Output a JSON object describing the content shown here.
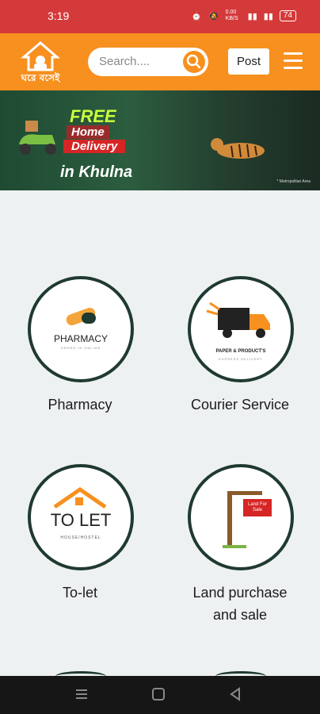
{
  "status_bar": {
    "time": "3:19",
    "data_speed": "0.00 KB/S",
    "battery": "74"
  },
  "app_bar": {
    "logo_text": "ঘরে বসেই",
    "search_placeholder": "Search....",
    "post_label": "Post"
  },
  "banner": {
    "line1": "FREE",
    "line2": "Home",
    "line3": "Delivery",
    "line4": "in Khulna",
    "note": "* Metropolitan Area"
  },
  "services": [
    {
      "label": "Pharmacy",
      "image_text": "PHARMACY",
      "image_subtext": "ORDER IN ONLINE"
    },
    {
      "label": "Courier Service",
      "image_text": "PAPER & PRODUCT'S",
      "image_subtext": "EXPRESS DELIVERY"
    },
    {
      "label": "To-let",
      "image_text": "TO LET",
      "image_subtext": "HOUSE/HOSTEL"
    },
    {
      "label": "Land purchase and sale",
      "image_text": "Land For Sale"
    }
  ],
  "colors": {
    "status_bar": "#d53a3a",
    "app_bar": "#f7901e",
    "circle_border": "#1f3a31"
  }
}
